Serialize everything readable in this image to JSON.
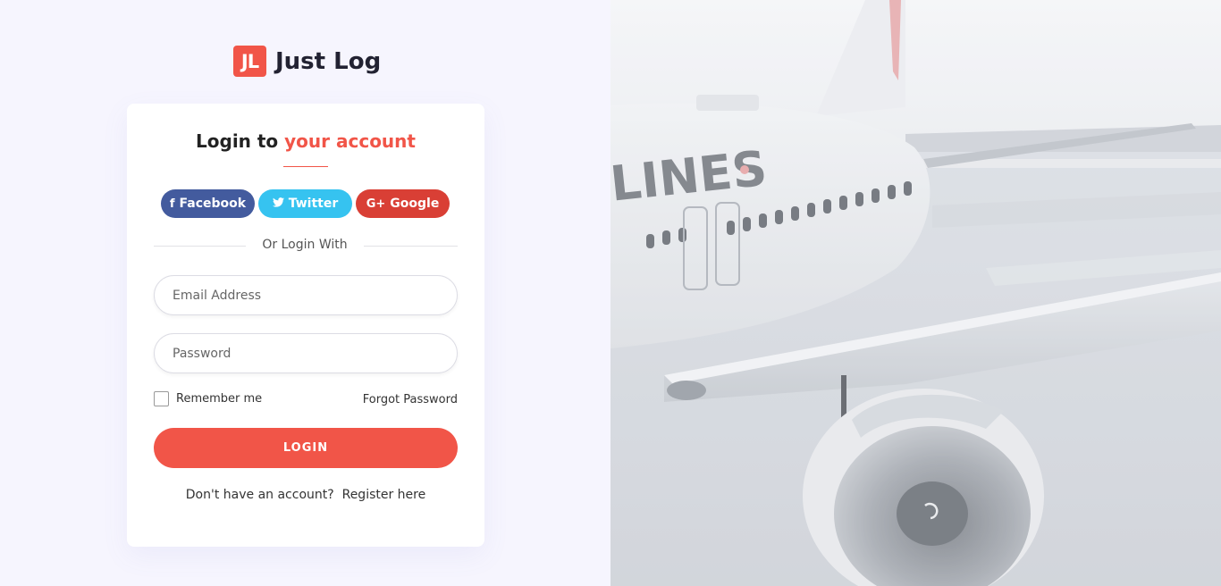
{
  "brand": {
    "logo_text": "JL",
    "name": "Just Log"
  },
  "colors": {
    "accent": "#f15548",
    "facebook": "#435b9e",
    "twitter": "#36c3f0",
    "google": "#d93f35",
    "page_bg": "#f6f5fe"
  },
  "login_card": {
    "title_plain": "Login to ",
    "title_accent": "your account",
    "social": {
      "facebook_icon": "f",
      "facebook_label": "Facebook",
      "twitter_icon": "twitter-bird",
      "twitter_label": "Twitter",
      "google_icon": "G+",
      "google_label": "Google"
    },
    "divider_text": "Or Login With",
    "email_placeholder": "Email Address",
    "password_placeholder": "Password",
    "remember_label": "Remember me",
    "forgot_label": "Forgot Password",
    "login_label": "LOGIN",
    "register_prompt": "Don't have an account?",
    "register_link": "Register here"
  },
  "hero_image": {
    "fuselage_text": "LINES"
  }
}
